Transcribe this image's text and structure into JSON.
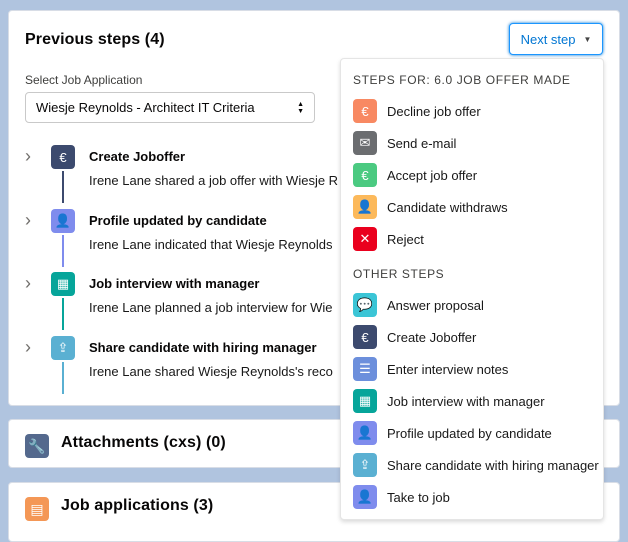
{
  "previous_steps": {
    "title": "Previous steps (4)",
    "next_step_label": "Next step",
    "select_label": "Select Job Application",
    "select_value": "Wiesje Reynolds - Architect IT Criteria",
    "items": [
      {
        "title": "Create Joboffer",
        "desc": "Irene Lane shared a job offer with Wiesje R",
        "icon": "euro-icon",
        "color": "#3c4a6e",
        "line": "#3c4a6e"
      },
      {
        "title": "Profile updated by candidate",
        "desc": "Irene Lane indicated that Wiesje Reynolds",
        "icon": "person-check-icon",
        "color": "#7f8ced",
        "line": "#7f8ced"
      },
      {
        "title": "Job interview with manager",
        "desc": "Irene Lane planned a job interview for Wie",
        "icon": "calendar-icon",
        "color": "#06a59a",
        "line": "#06a59a"
      },
      {
        "title": "Share candidate with hiring manager",
        "desc": "Irene Lane shared Wiesje Reynolds's reco",
        "icon": "share-person-icon",
        "color": "#5ab0d2",
        "line": "#5ab0d2"
      }
    ]
  },
  "attachments": {
    "title": "Attachments (cxs) (0)",
    "icon": "wrench-icon",
    "color": "#54698d"
  },
  "job_applications": {
    "title": "Job applications (3)",
    "icon": "document-icon",
    "color": "#f49756"
  },
  "dropdown": {
    "section1_header": "Steps for: 6.0 Job offer made",
    "section1_items": [
      {
        "label": "Decline job offer",
        "icon": "euro-x-icon",
        "color": "#f88962"
      },
      {
        "label": "Send e-mail",
        "icon": "email-icon",
        "color": "#6b6d70"
      },
      {
        "label": "Accept job offer",
        "icon": "euro-check-icon",
        "color": "#4bca81"
      },
      {
        "label": "Candidate withdraws",
        "icon": "person-icon",
        "color": "#fcb95b"
      },
      {
        "label": "Reject",
        "icon": "x-icon",
        "color": "#ea001e"
      }
    ],
    "section2_header": "Other steps",
    "section2_items": [
      {
        "label": "Answer proposal",
        "icon": "chat-icon",
        "color": "#3bc5d6"
      },
      {
        "label": "Create Joboffer",
        "icon": "euro-icon",
        "color": "#3c4a6e"
      },
      {
        "label": "Enter interview notes",
        "icon": "notes-icon",
        "color": "#6c8fdc"
      },
      {
        "label": "Job interview with manager",
        "icon": "calendar-icon",
        "color": "#06a59a"
      },
      {
        "label": "Profile updated by candidate",
        "icon": "person-check-icon",
        "color": "#7f8ced"
      },
      {
        "label": "Share candidate with hiring manager",
        "icon": "share-person-icon",
        "color": "#5ab0d2"
      },
      {
        "label": "Take to job",
        "icon": "person-check-icon",
        "color": "#7f8ced"
      }
    ]
  }
}
